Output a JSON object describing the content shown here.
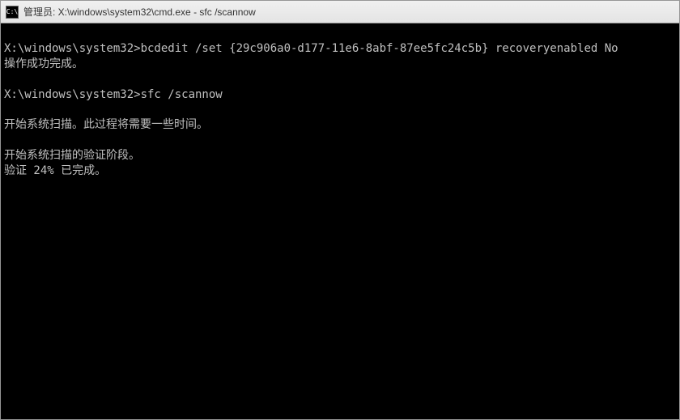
{
  "titlebar": {
    "icon_label": "C:\\",
    "title": "管理员: X:\\windows\\system32\\cmd.exe - sfc  /scannow"
  },
  "terminal": {
    "lines": [
      "X:\\windows\\system32>bcdedit /set {29c906a0-d177-11e6-8abf-87ee5fc24c5b} recoveryenabled No",
      "操作成功完成。",
      "",
      "X:\\windows\\system32>sfc /scannow",
      "",
      "开始系统扫描。此过程将需要一些时间。",
      "",
      "开始系统扫描的验证阶段。",
      "验证 24% 已完成。"
    ]
  }
}
